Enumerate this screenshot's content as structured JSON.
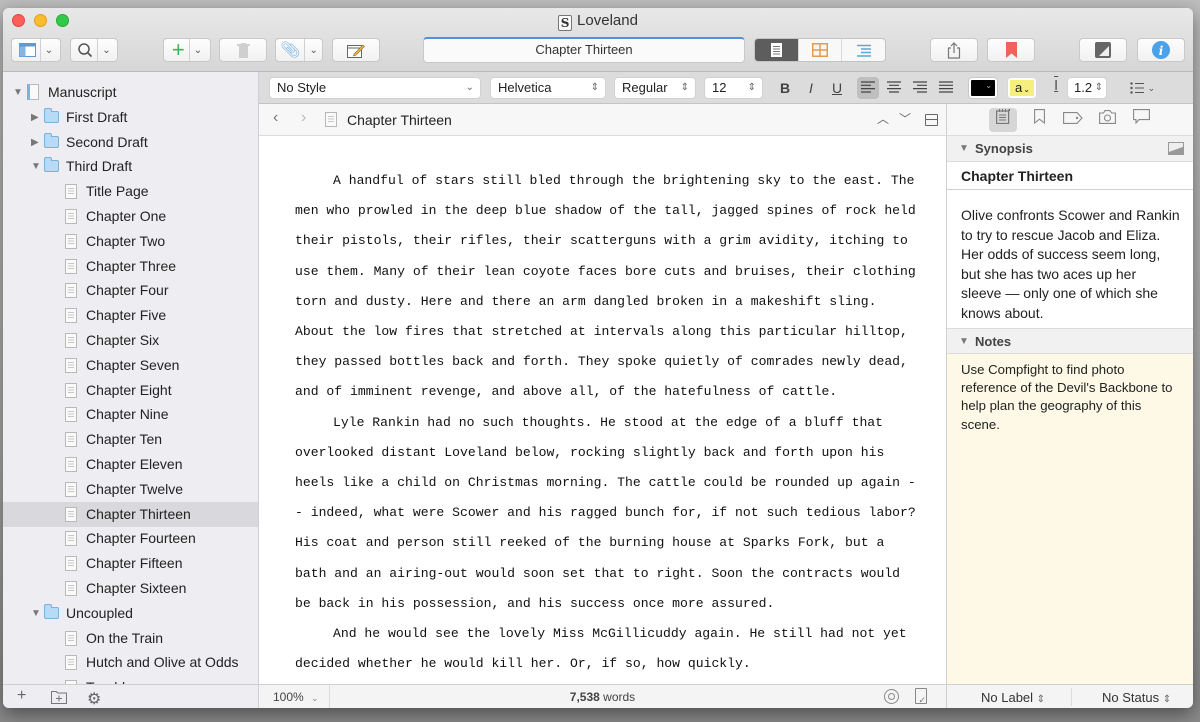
{
  "window": {
    "title": "Loveland",
    "app_logo": "S"
  },
  "toolbar": {
    "binder_toggle_icon": "sidebar-icon",
    "search_icon": "magnifier-icon",
    "add_icon": "plus-icon",
    "trash_icon": "trash-icon",
    "attach_icon": "paperclip-icon",
    "compose_icon": "compose-icon",
    "document_title": "Chapter Thirteen",
    "view_modes": [
      "document",
      "corkboard",
      "outliner"
    ],
    "active_view": "document",
    "share_icon": "share-icon",
    "bookmark_icon": "bookmark-icon",
    "composition_icon": "composition-mode-icon",
    "inspector_icon": "info-icon",
    "accent_color": "#5a8edc"
  },
  "formatbar": {
    "style": "No Style",
    "font": "Helvetica",
    "weight": "Regular",
    "size": "12",
    "bold": "B",
    "italic": "I",
    "underline": "U",
    "alignment": "left",
    "text_color": "#000000",
    "highlight_label": "a",
    "highlight_color": "#f6ef7f",
    "line_spacing": "1.2"
  },
  "binder": {
    "items": [
      {
        "label": "Manuscript",
        "type": "manuscript",
        "level": 0,
        "expanded": true
      },
      {
        "label": "First Draft",
        "type": "folder",
        "level": 1,
        "expanded": false
      },
      {
        "label": "Second Draft",
        "type": "folder",
        "level": 1,
        "expanded": false
      },
      {
        "label": "Third Draft",
        "type": "folder",
        "level": 1,
        "expanded": true
      },
      {
        "label": "Title Page",
        "type": "doc",
        "level": 2
      },
      {
        "label": "Chapter One",
        "type": "doc",
        "level": 2
      },
      {
        "label": "Chapter Two",
        "type": "doc",
        "level": 2
      },
      {
        "label": "Chapter Three",
        "type": "doc",
        "level": 2
      },
      {
        "label": "Chapter Four",
        "type": "doc",
        "level": 2
      },
      {
        "label": "Chapter Five",
        "type": "doc",
        "level": 2
      },
      {
        "label": "Chapter Six",
        "type": "doc",
        "level": 2
      },
      {
        "label": "Chapter Seven",
        "type": "doc",
        "level": 2
      },
      {
        "label": "Chapter Eight",
        "type": "doc",
        "level": 2
      },
      {
        "label": "Chapter Nine",
        "type": "doc",
        "level": 2
      },
      {
        "label": "Chapter Ten",
        "type": "doc",
        "level": 2
      },
      {
        "label": "Chapter Eleven",
        "type": "doc",
        "level": 2
      },
      {
        "label": "Chapter Twelve",
        "type": "doc",
        "level": 2
      },
      {
        "label": "Chapter Thirteen",
        "type": "doc",
        "level": 2,
        "selected": true
      },
      {
        "label": "Chapter Fourteen",
        "type": "doc",
        "level": 2
      },
      {
        "label": "Chapter Fifteen",
        "type": "doc",
        "level": 2
      },
      {
        "label": "Chapter Sixteen",
        "type": "doc",
        "level": 2
      },
      {
        "label": "Uncoupled",
        "type": "folder",
        "level": 1,
        "expanded": true
      },
      {
        "label": "On the Train",
        "type": "doc",
        "level": 2
      },
      {
        "label": "Hutch and Olive at Odds",
        "type": "doc",
        "level": 2
      },
      {
        "label": "Trouble",
        "type": "doc",
        "level": 2
      }
    ],
    "footer": {
      "add": "+",
      "add_folder": "add-folder-icon",
      "settings": "gear-icon"
    }
  },
  "editor": {
    "header": {
      "back": "‹",
      "forward": "›",
      "doc_name": "Chapter Thirteen"
    },
    "paragraphs": [
      "A handful of stars still bled through the brightening sky to the east. The men who prowled in the deep blue shadow of the tall, jagged spines of rock held their pistols, their rifles, their scatterguns with a grim avidity, itching to use them. Many of their lean coyote faces bore cuts and bruises, their clothing torn and dusty. Here and there an arm dangled broken in a makeshift sling. About the low fires that stretched at intervals along this particular hilltop, they passed bottles back and forth. They spoke quietly of comrades newly dead, and of imminent revenge, and above all, of the hatefulness of cattle.",
      "Lyle Rankin had no such thoughts. He stood at the edge of a bluff that overlooked distant Loveland below, rocking slightly back and forth upon his heels like a child on Christmas morning. The cattle could be rounded up again -- indeed, what were Scower and his ragged bunch for, if not such tedious labor? His coat and person still reeked of the burning house at Sparks Fork, but a bath and an airing-out would soon set that to right. Soon the contracts would be back in his possession, and his success once more assured.",
      "And he would see the lovely Miss McGillicuddy again. He still had not yet decided whether he would kill her. Or, if so, how quickly."
    ],
    "footer": {
      "zoom": "100%",
      "word_count": "7,538",
      "word_unit": "words"
    }
  },
  "inspector": {
    "tabs": [
      "notes",
      "bookmarks",
      "metadata",
      "snapshots",
      "comments"
    ],
    "active_tab": "notes",
    "synopsis": {
      "header": "Synopsis",
      "title": "Chapter Thirteen",
      "text": "Olive confronts Scower and Rankin to try to rescue Jacob and Eliza. Her odds of success seem long, but she has two aces up her sleeve — only one of which she knows about."
    },
    "notes": {
      "header": "Notes",
      "text": "Use Compfight to find photo reference of the Devil's Backbone to help plan the geography of this scene.",
      "background": "#fdf9e6"
    },
    "footer": {
      "label": "No Label",
      "status": "No Status"
    }
  }
}
